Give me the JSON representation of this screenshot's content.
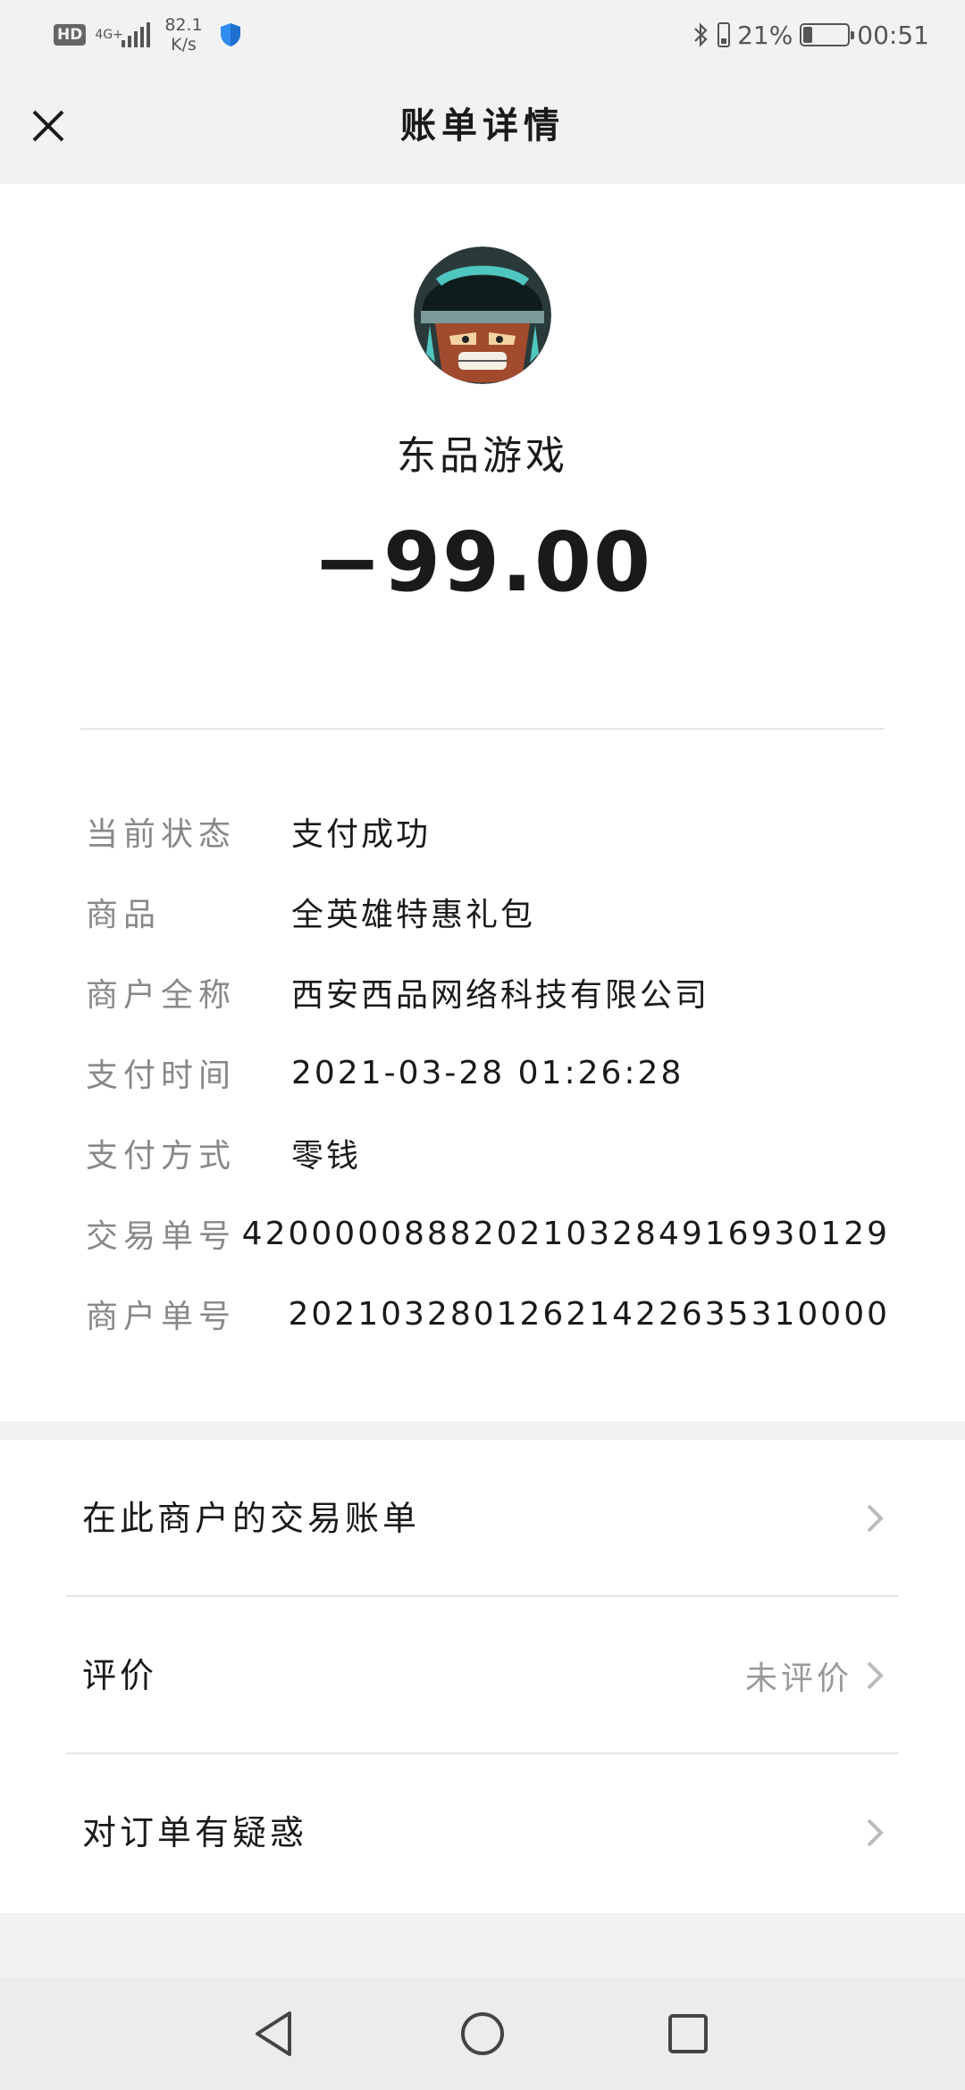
{
  "status_bar": {
    "hd": "HD",
    "network": "4G+",
    "speed_value": "82.1",
    "speed_unit": "K/s",
    "battery_percent": "21%",
    "time": "00:51"
  },
  "header": {
    "title": "账单详情"
  },
  "merchant": {
    "name": "东品游戏",
    "amount": "−99.00"
  },
  "details": [
    {
      "label": "当前状态",
      "value": "支付成功"
    },
    {
      "label": "商品",
      "value": "全英雄特惠礼包"
    },
    {
      "label": "商户全称",
      "value": "西安西品网络科技有限公司"
    },
    {
      "label": "支付时间",
      "value": "2021-03-28 01:26:28"
    },
    {
      "label": "支付方式",
      "value": "零钱"
    },
    {
      "label": "交易单号",
      "value": "4200000888202103284916930129"
    },
    {
      "label": "商户单号",
      "value": "2021032801262142263531000​0"
    }
  ],
  "options": [
    {
      "label": "在此商户的交易账单",
      "status": ""
    },
    {
      "label": "评价",
      "status": "未评价"
    },
    {
      "label": "对订单有疑惑",
      "status": ""
    }
  ],
  "colors": {
    "background": "#f2f2f2",
    "card": "#ffffff",
    "label_gray": "#888888",
    "shield_blue": "#2f8cf0"
  }
}
